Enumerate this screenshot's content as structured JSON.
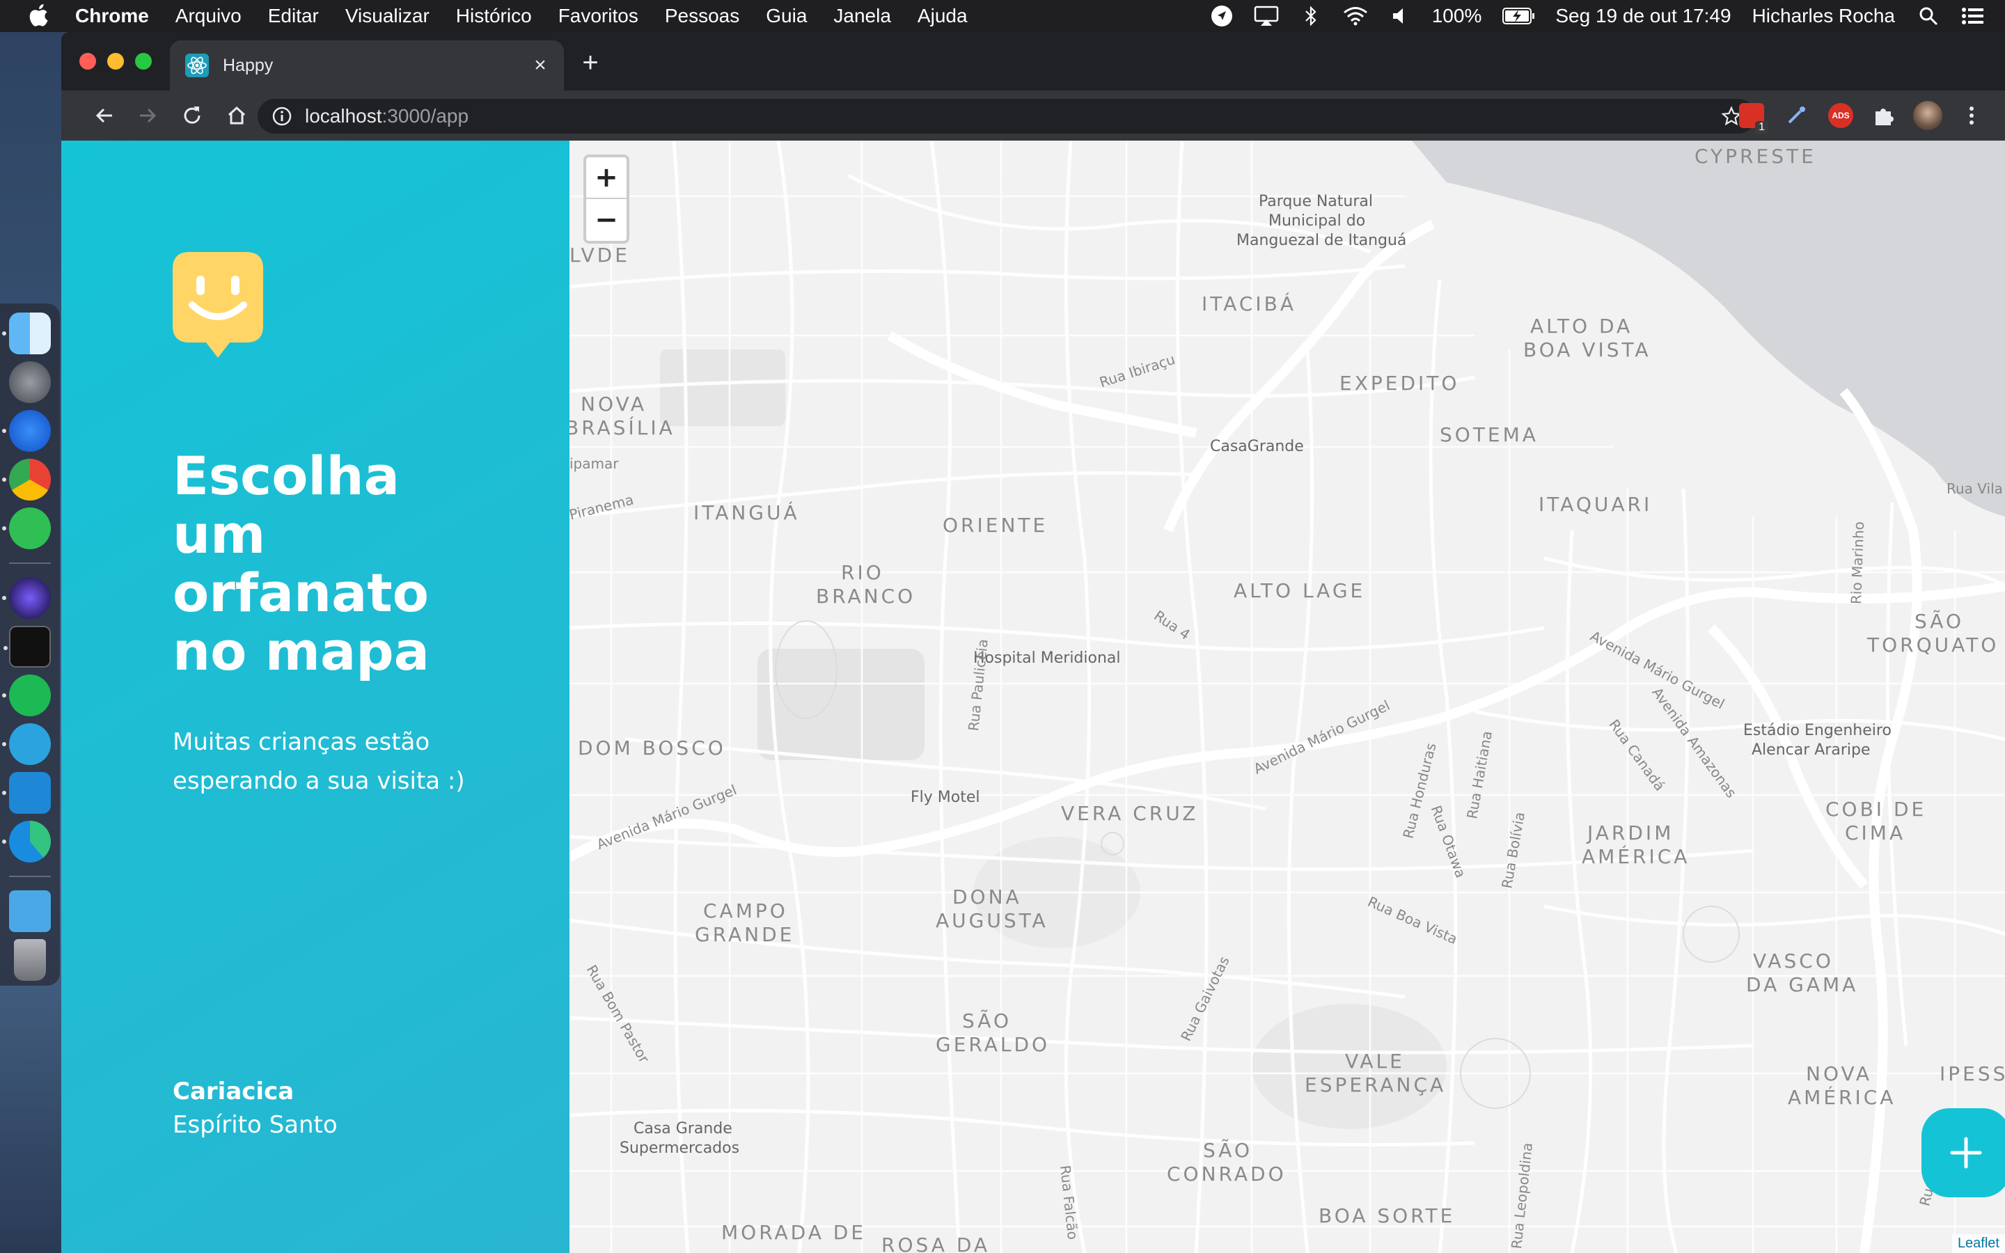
{
  "menubar": {
    "app_name": "Chrome",
    "items": [
      "Arquivo",
      "Editar",
      "Visualizar",
      "Histórico",
      "Favoritos",
      "Pessoas",
      "Guia",
      "Janela",
      "Ajuda"
    ],
    "battery": "100%",
    "datetime": "Seg 19 de out  17:49",
    "user": "Hicharles Rocha"
  },
  "browser": {
    "tab_title": "Happy",
    "url_host": "localhost",
    "url_path": ":3000/app",
    "extension_badge": "1",
    "ads_badge": "ADS"
  },
  "sidebar": {
    "headline": [
      "Escolha",
      "um",
      "orfanato",
      "no mapa"
    ],
    "subtitle": "Muitas crianças estão esperando a sua visita :)",
    "city": "Cariacica",
    "state": "Espírito Santo"
  },
  "map": {
    "zoom_in": "+",
    "zoom_out": "−",
    "attribution": "Leaflet",
    "districts": [
      "CYPRESTE",
      "ITACIBÁ",
      "ALTO DA",
      "BOA VISTA",
      "EXPEDITO",
      "SOTEMA",
      "NOVA",
      "BRASÍLIA",
      "ITANGUÁ",
      "ORIENTE",
      "ITAQUARI",
      "RIO",
      "BRANCO",
      "ALTO LAGE",
      "SÃO",
      "TORQUATO",
      "DOM BOSCO",
      "VERA CRUZ",
      "JARDIM",
      "AMÉRICA",
      "COBI DE",
      "CIMA",
      "CAMPO",
      "GRANDE",
      "DONA",
      "AUGUSTA",
      "VASCO",
      "DA GAMA",
      "SÃO",
      "GERALDO",
      "VALE",
      "ESPERANÇA",
      "NOVA",
      "AMÉRICA",
      "IPESSA",
      "SÃO",
      "CONRADO",
      "BOA SORTE",
      "MORADA DE",
      "ROSA DA",
      "LVDE"
    ],
    "pois": [
      "Parque Natural",
      "Municipal do",
      "Manguezal de Itanguá",
      "CasaGrande",
      "Hospital Meridional",
      "Fly Motel",
      "Estádio Engenheiro",
      "Alencar Araripe",
      "Casa Grande",
      "Supermercados"
    ],
    "streets": [
      "Rua Ibiraçu",
      "Rua 4",
      "Rua Paulicéia",
      "Avenida Mário Gurgel",
      "Avenida Mário Gurgel",
      "Avenida Mário Gurgel",
      "Avenida Amazonas",
      "Rua Canadá",
      "Rua Honduras",
      "Rua Haitiana",
      "Rua Otawa",
      "Rua Bolívia",
      "Rua Boa Vista",
      "Rua Gaivotas",
      "Rua Bom Pastor",
      "Rua Falcão",
      "Rua Leopoldina",
      "Rua Jaguaré",
      "Rio Marinho",
      "Rua Vila",
      "ipamar",
      "Piranema"
    ]
  }
}
